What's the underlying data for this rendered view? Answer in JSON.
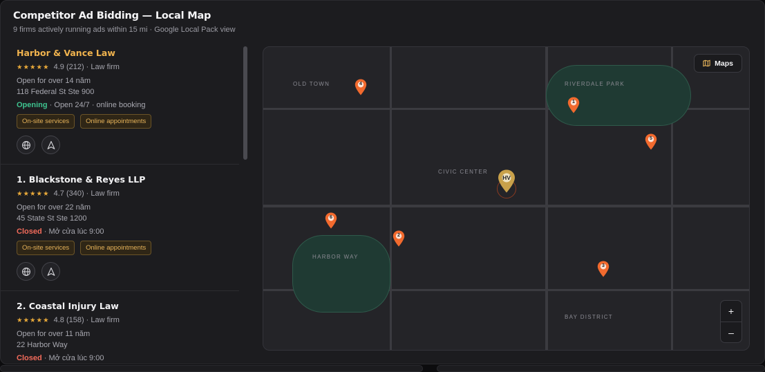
{
  "header": {
    "title": "Competitor Ad Bidding — Local Map",
    "subtitle": "9 firms actively running ads within 15 mi · Google Local Pack view"
  },
  "listings": [
    {
      "name": "Harbor & Vance Law",
      "own": true,
      "stars": "★★★★★",
      "rating": "4.9 (212) · Law firm",
      "tenure": "Open for over 14 năm",
      "address": "118 Federal St Ste 900",
      "status": "Opening",
      "status_type": "open",
      "hours": " · Open 24/7 · online booking",
      "tags": [
        "On-site services",
        "Online appointments"
      ]
    },
    {
      "name": "1. Blackstone & Reyes LLP",
      "own": false,
      "stars": "★★★★★",
      "rating": "4.7 (340) · Law firm",
      "tenure": "Open for over 22 năm",
      "address": "45 State St Ste 1200",
      "status": "Closed",
      "status_type": "closed",
      "hours": " · Mở cửa lúc 9:00",
      "tags": [
        "On-site services",
        "Online appointments"
      ]
    },
    {
      "name": "2. Coastal Injury Law",
      "own": false,
      "stars": "★★★★★",
      "rating": "4.8 (158) · Law firm",
      "tenure": "Open for over 11 năm",
      "address": "22 Harbor Way",
      "status": "Closed",
      "status_type": "closed",
      "hours": " · Mở cửa lúc 9:00",
      "tags": []
    }
  ],
  "map": {
    "areas": {
      "old_town": "OLD TOWN",
      "riverdale_park": "RIVERDALE PARK",
      "civic_center": "CIVIC CENTER",
      "harbor_way": "HARBOR WAY",
      "bay_district": "BAY DISTRICT"
    },
    "maps_button": "Maps",
    "zoom_in": "+",
    "zoom_out": "–",
    "own_pin": "HV",
    "pins": [
      "1",
      "2",
      "3",
      "4",
      "5",
      "6"
    ]
  },
  "colors": {
    "accent": "#f0b34e",
    "pin": "#f26a2e",
    "own_pin": "#c9a14a",
    "open": "#3ec28f",
    "closed": "#f26b5b"
  },
  "icons": {
    "website": "globe-icon",
    "directions": "navigation-arrow-icon",
    "maps": "map-icon"
  }
}
